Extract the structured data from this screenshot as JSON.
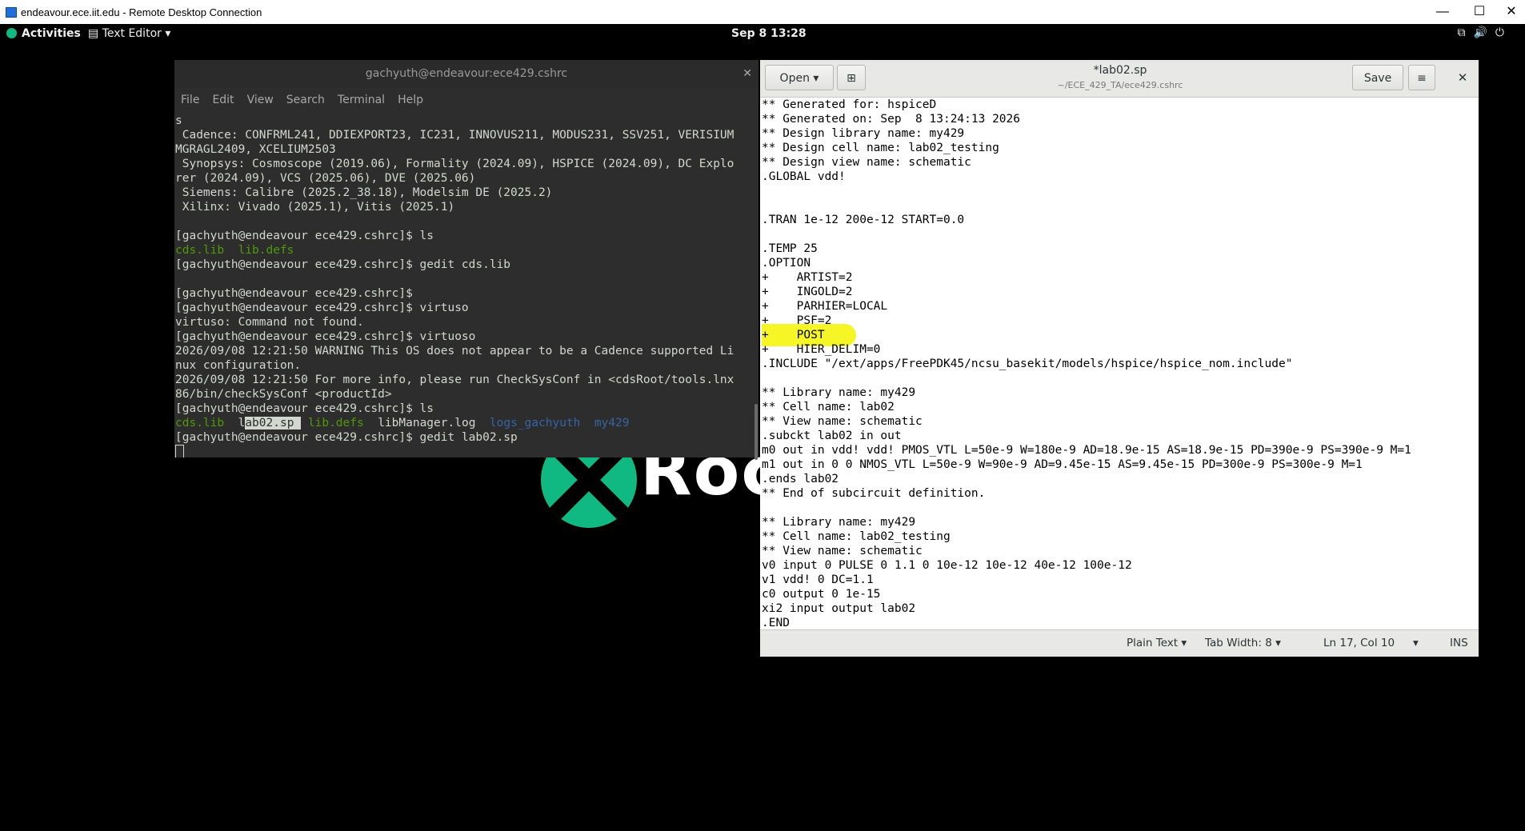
{
  "rdp": {
    "title": "endeavour.ece.iit.edu - Remote Desktop Connection",
    "minimize": "—",
    "maximize": "☐",
    "close": "✕"
  },
  "gnome": {
    "activities": "Activities",
    "app_menu": "Text Editor ▾",
    "clock": "Sep 8  13:28",
    "tray_icons": "network-icon volume-icon power-icon"
  },
  "desktop": {
    "logo_text": "Rock"
  },
  "terminal": {
    "title": "gachyuth@endeavour:ece429.cshrc",
    "menu": [
      "File",
      "Edit",
      "View",
      "Search",
      "Terminal",
      "Help"
    ],
    "lines": [
      "s",
      " Cadence: CONFRML241, DDIEXPORT23, IC231, INNOVUS211, MODUS231, SSV251, VERISIUM",
      "MGRAGL2409, XCELIUM2503",
      " Synopsys: Cosmoscope (2019.06), Formality (2024.09), HSPICE (2024.09), DC Explo",
      "rer (2024.09), VCS (2025.06), DVE (2025.06)",
      " Siemens: Calibre (2025.2_38.18), Modelsim DE (2025.2)",
      " Xilinx: Vivado (2025.1), Vitis (2025.1)",
      "",
      "[gachyuth@endeavour ece429.cshrc]$ ls"
    ],
    "ls1": [
      "cds.lib",
      "lib.defs"
    ],
    "lines2": [
      "[gachyuth@endeavour ece429.cshrc]$ gedit cds.lib",
      "",
      "[gachyuth@endeavour ece429.cshrc]$",
      "[gachyuth@endeavour ece429.cshrc]$ virtuso",
      "virtuso: Command not found.",
      "[gachyuth@endeavour ece429.cshrc]$ virtuoso",
      "2026/09/08 12:21:50 WARNING This OS does not appear to be a Cadence supported Li",
      "nux configuration.",
      "2026/09/08 12:21:50 For more info, please run CheckSysConf in <cdsRoot/tools.lnx",
      "86/bin/checkSysConf <productId>",
      "[gachyuth@endeavour ece429.cshrc]$ ls"
    ],
    "ls2": {
      "cds": "cds.lib",
      "lab_l": "l",
      "lab_sel": "ab02.sp ",
      "libdefs": "lib.defs",
      "libmgr": "libManager.log",
      "logs": "logs_gachyuth",
      "my429": "my429"
    },
    "last": "[gachyuth@endeavour ece429.cshrc]$ gedit lab02.sp"
  },
  "gedit": {
    "open_label": "Open",
    "title": "*lab02.sp",
    "subtitle": "~/ECE_429_TA/ece429.cshrc",
    "save_label": "Save",
    "menu_icon": "≡",
    "close_icon": "✕",
    "lines": [
      "** Generated for: hspiceD",
      "** Generated on: Sep  8 13:24:13 2026",
      "** Design library name: my429",
      "** Design cell name: lab02_testing",
      "** Design view name: schematic",
      ".GLOBAL vdd!",
      "",
      "",
      ".TRAN 1e-12 200e-12 START=0.0",
      "",
      ".TEMP 25",
      ".OPTION",
      "+    ARTIST=2",
      "+    INGOLD=2",
      "+    PARHIER=LOCAL",
      "+    PSF=2",
      "+    POST",
      "+    HIER_DELIM=0",
      ".INCLUDE \"/ext/apps/FreePDK45/ncsu_basekit/models/hspice/hspice_nom.include\"",
      "",
      "** Library name: my429",
      "** Cell name: lab02",
      "** View name: schematic",
      ".subckt lab02 in out",
      "m0 out in vdd! vdd! PMOS_VTL L=50e-9 W=180e-9 AD=18.9e-15 AS=18.9e-15 PD=390e-9 PS=390e-9 M=1",
      "m1 out in 0 0 NMOS_VTL L=50e-9 W=90e-9 AD=9.45e-15 AS=9.45e-15 PD=300e-9 PS=300e-9 M=1",
      ".ends lab02",
      "** End of subcircuit definition.",
      "",
      "** Library name: my429",
      "** Cell name: lab02_testing",
      "** View name: schematic",
      "v0 input 0 PULSE 0 1.1 0 10e-12 10e-12 40e-12 100e-12",
      "v1 vdd! 0 DC=1.1",
      "c0 output 0 1e-15",
      "xi2 input output lab02",
      ".END"
    ],
    "status": {
      "language": "Plain Text ▾",
      "tab_width": "Tab Width: 8 ▾",
      "position": "Ln 17, Col 10",
      "position_menu": "▾",
      "mode": "INS"
    }
  }
}
